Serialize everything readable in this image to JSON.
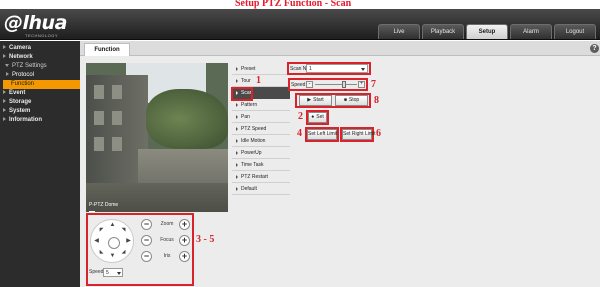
{
  "caption": "Setup PTZ Function - Scan",
  "header": {
    "logo": "@lhua",
    "logo_sub": "TECHNOLOGY",
    "nav": [
      {
        "label": "Live",
        "active": false
      },
      {
        "label": "Playback",
        "active": false
      },
      {
        "label": "Setup",
        "active": true
      },
      {
        "label": "Alarm",
        "active": false
      },
      {
        "label": "Logout",
        "active": false
      }
    ]
  },
  "sidebar": {
    "items": [
      {
        "label": "Camera"
      },
      {
        "label": "Network"
      },
      {
        "label": "PTZ Settings"
      },
      {
        "label": "Protocol"
      },
      {
        "label": "Function"
      },
      {
        "label": "Event"
      },
      {
        "label": "Storage"
      },
      {
        "label": "System"
      },
      {
        "label": "Information"
      }
    ]
  },
  "content": {
    "tab": "Function",
    "help_icon": "?",
    "video_overlay": "P-PTZ Dome",
    "menu": [
      {
        "label": "Preset"
      },
      {
        "label": "Tour"
      },
      {
        "label": "Scan"
      },
      {
        "label": "Pattern"
      },
      {
        "label": "Pan"
      },
      {
        "label": "PTZ Speed"
      },
      {
        "label": "Idle Motion"
      },
      {
        "label": "PowerUp"
      },
      {
        "label": "Time Task"
      },
      {
        "label": "PTZ Restart"
      },
      {
        "label": "Default"
      }
    ]
  },
  "ptz_control": {
    "zoom_label": "Zoom",
    "focus_label": "Focus",
    "iris_label": "Iris",
    "speed_label": "Speed",
    "speed_value": "5"
  },
  "scan": {
    "scan_no_label": "Scan No.",
    "scan_no_value": "1",
    "speed_label": "Speed",
    "speed_level": 0.72,
    "start_label": "Start",
    "stop_label": "Stop",
    "set_label": "Set",
    "set_left_label": "Set Left Limit",
    "set_right_label": "Set Right Limit"
  },
  "annotations": {
    "n1": "1",
    "n2": "2",
    "n35": "3 - 5",
    "n4": "4",
    "n6": "6",
    "n7": "7",
    "n8": "8"
  },
  "colors": {
    "annotation_red": "#d8232a",
    "active_orange": "#f39800",
    "header_dark": "#2c2c2c"
  }
}
